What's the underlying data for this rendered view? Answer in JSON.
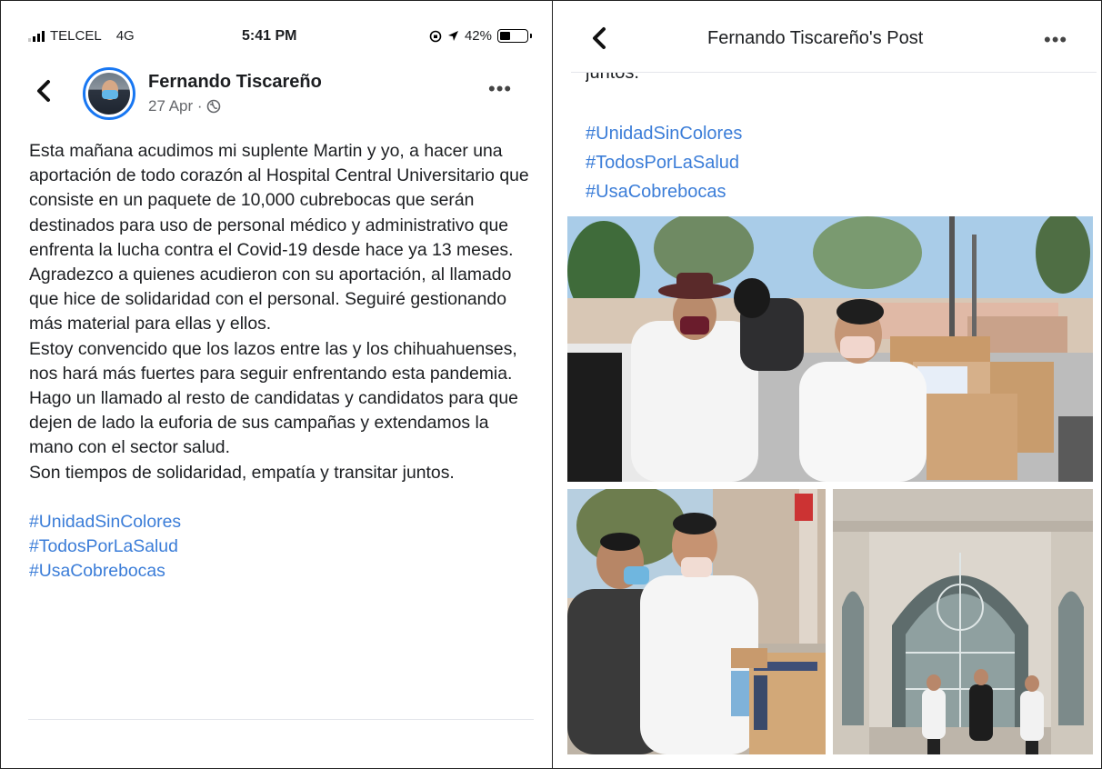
{
  "status_bar": {
    "carrier": "TELCEL",
    "network": "4G",
    "time": "5:41 PM",
    "battery": "42%",
    "battery_level": 0.42
  },
  "post": {
    "author": "Fernando Tiscareño",
    "date": "27 Apr ·",
    "paragraphs": [
      "Esta mañana acudimos mi suplente Martin y yo, a hacer una aportación de todo corazón al Hospital Central Universitario que consiste en un paquete de 10,000 cubrebocas que serán destinados para uso de personal médico y administrativo que enfrenta la lucha contra el Covid-19 desde hace ya 13 meses.",
      "Agradezco a quienes acudieron con su aportación, al llamado que hice de solidaridad con el personal. Seguiré gestionando más material para ellas y ellos.",
      "Estoy convencido que los lazos entre las y los chihuahuenses, nos hará más fuertes para seguir enfrentando esta pandemia.",
      "Hago un llamado al resto de candidatas y candidatos para que dejen de lado la euforia de sus campañas y extendamos la mano con el sector salud.",
      "Son tiempos de solidaridad, empatía y transitar juntos."
    ],
    "hashtags": [
      "#UnidadSinColores",
      "#TodosPorLaSalud",
      "#UsaCobrebocas"
    ]
  },
  "detail_view": {
    "title": "Fernando Tiscareño's Post",
    "partial_text": "juntos.",
    "hashtags": [
      "#UnidadSinColores",
      "#TodosPorLaSalud",
      "#UsaCobrebocas"
    ]
  },
  "icons": {
    "back": "chevron-left-icon",
    "more": "more-horizontal-icon",
    "privacy": "globe-icon",
    "location": "location-arrow-icon",
    "orientation_lock": "orientation-lock-icon"
  },
  "colors": {
    "link": "#3b7dd8",
    "accent": "#1877f2",
    "meta": "#65676b"
  }
}
